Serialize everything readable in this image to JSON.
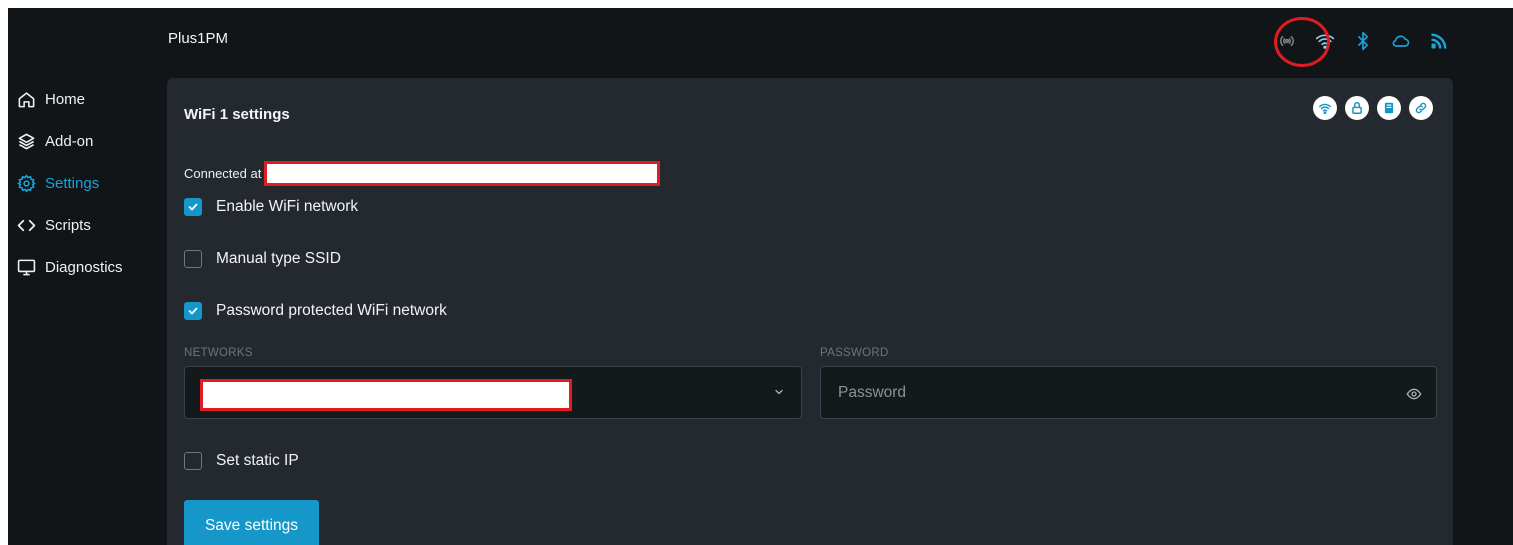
{
  "header": {
    "device_name": "Plus1PM"
  },
  "status_icons": [
    {
      "icon": "broadcast-icon",
      "color": "#8a939a"
    },
    {
      "icon": "wifi-icon",
      "color": "#8fd0ea"
    },
    {
      "icon": "bluetooth-icon",
      "color": "#1aa3d6"
    },
    {
      "icon": "cloud-icon",
      "color": "#1aa3d6"
    },
    {
      "icon": "rss-icon",
      "color": "#1aa3d6"
    }
  ],
  "sidebar": {
    "items": [
      {
        "label": "Home",
        "icon": "home-icon",
        "active": false
      },
      {
        "label": "Add-on",
        "icon": "layers-icon",
        "active": false
      },
      {
        "label": "Settings",
        "icon": "gear-icon",
        "active": true
      },
      {
        "label": "Scripts",
        "icon": "code-icon",
        "active": false
      },
      {
        "label": "Diagnostics",
        "icon": "monitor-icon",
        "active": false
      }
    ]
  },
  "card": {
    "title": "WiFi 1 settings",
    "actions": [
      "wifi-icon",
      "lock-icon",
      "book-icon",
      "link-icon"
    ],
    "connected_label": "Connected at",
    "checkboxes": {
      "enable_wifi": {
        "label": "Enable WiFi network",
        "checked": true
      },
      "manual_ssid": {
        "label": "Manual type SSID",
        "checked": false
      },
      "password_protected": {
        "label": "Password protected WiFi network",
        "checked": true
      },
      "static_ip": {
        "label": "Set static IP",
        "checked": false
      }
    },
    "networks_label": "NETWORKS",
    "password_label": "PASSWORD",
    "password_placeholder": "Password",
    "save_label": "Save settings"
  },
  "colors": {
    "accent": "#1597c9",
    "background": "#111517",
    "card": "#23292e",
    "highlight": "#e11b22"
  }
}
